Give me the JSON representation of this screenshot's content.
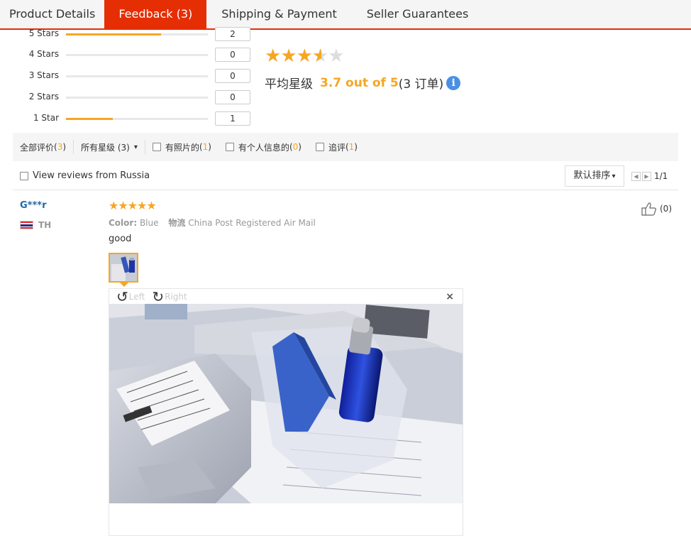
{
  "tabs": [
    {
      "label": "Product Details"
    },
    {
      "label": "Feedback (3)"
    },
    {
      "label": "Shipping & Payment"
    },
    {
      "label": "Seller Guarantees"
    }
  ],
  "distribution": [
    {
      "label": "5 Stars",
      "count": "2",
      "fraction": 0.67
    },
    {
      "label": "4 Stars",
      "count": "0",
      "fraction": 0
    },
    {
      "label": "3 Stars",
      "count": "0",
      "fraction": 0
    },
    {
      "label": "2 Stars",
      "count": "0",
      "fraction": 0
    },
    {
      "label": "1 Star",
      "count": "1",
      "fraction": 0.33
    }
  ],
  "summary": {
    "rating": 3.7,
    "avg_prefix": "平均星级",
    "avg_score": "3.7 out of 5",
    "orders": "(3 订单)",
    "info_glyph": "i"
  },
  "filters": {
    "all_label": "全部评价",
    "all_count_open": "(",
    "all_count": "3",
    "all_count_close": ")",
    "star_select": "所有星级 (3)",
    "with_photos": "有照片的",
    "with_photos_count": "1",
    "with_info": "有个人信息的",
    "with_info_count": "0",
    "followup": "追评",
    "followup_count": "1"
  },
  "russia_label": "View reviews from Russia",
  "sort_label": "默认排序",
  "pager": {
    "text": "1/1"
  },
  "review": {
    "reviewer": "G***r",
    "country": "TH",
    "rating": 5,
    "color_label": "Color:",
    "color_value": "Blue",
    "logistics_label": "物流",
    "logistics_value": "China Post Registered Air Mail",
    "text": "good",
    "helpful": "(0)"
  },
  "viewer": {
    "rotate_left": "Left",
    "rotate_right": "Right",
    "close": "×"
  },
  "colors": {
    "accent": "#e62e04",
    "star": "#f6a623",
    "link": "#1f67a8"
  }
}
